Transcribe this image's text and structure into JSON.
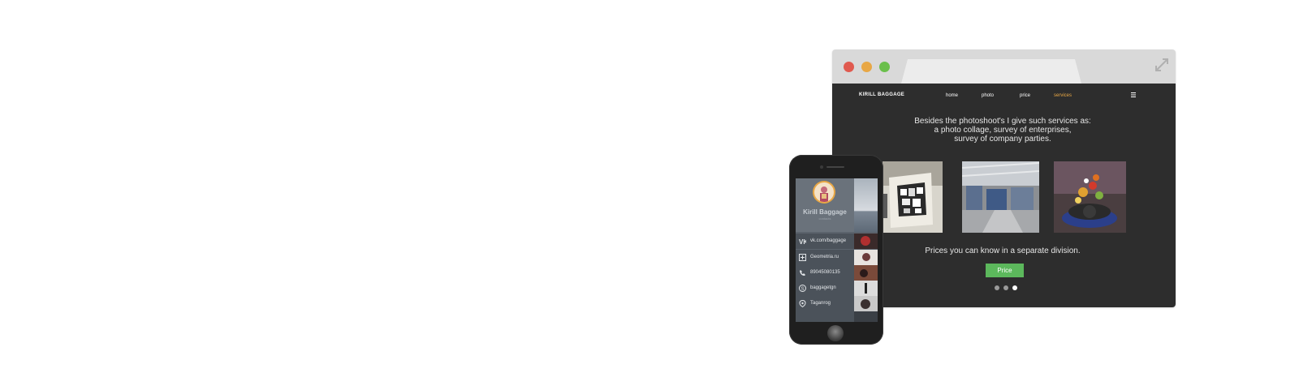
{
  "browser": {
    "site_logo": "Kirill Baggage",
    "nav": [
      {
        "label": "home",
        "active": false
      },
      {
        "label": "photo",
        "active": false
      },
      {
        "label": "price",
        "active": false
      },
      {
        "label": "services",
        "active": true
      }
    ],
    "intro_lines": [
      "Besides  the photoshoot's I give such services as:",
      "a photo collage, survey of enterprises,",
      "survey of company parties."
    ],
    "prices_text": "Prices you can know in a separate division.",
    "price_button": "Price",
    "slides": {
      "count": 3,
      "active_index": 2
    },
    "icons": [
      "close-dot",
      "minimize-dot",
      "maximize-dot",
      "expand-icon",
      "menu-icon"
    ],
    "colors": {
      "accent": "#e8a745",
      "button": "#5cb85c",
      "background": "#2d2d2d"
    }
  },
  "phone": {
    "profile_name": "Kirill Baggage",
    "profile_sub": "contacts",
    "contacts": [
      {
        "icon": "vk-icon",
        "text": "vk.com/baggage"
      },
      {
        "icon": "site-icon",
        "text": "Geometria.ru"
      },
      {
        "icon": "phone-icon",
        "text": "89045080135"
      },
      {
        "icon": "skype-icon",
        "text": "baggagetgn"
      },
      {
        "icon": "location-icon",
        "text": "Taganrog"
      }
    ]
  }
}
